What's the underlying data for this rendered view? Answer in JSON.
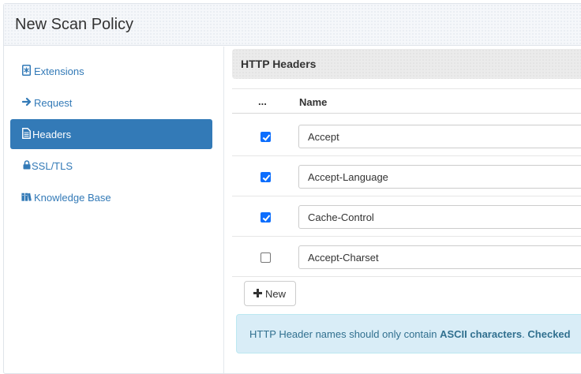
{
  "panel": {
    "title": "New Scan Policy"
  },
  "sidebar": {
    "items": [
      {
        "label": "Extensions",
        "icon": "extensions-icon",
        "active": false
      },
      {
        "label": "Request",
        "icon": "arrow-right-icon",
        "active": false
      },
      {
        "label": "Headers",
        "icon": "document-icon",
        "active": true
      },
      {
        "label": "SSL/TLS",
        "icon": "lock-icon",
        "active": false
      },
      {
        "label": "Knowledge Base",
        "icon": "books-icon",
        "active": false
      }
    ]
  },
  "main": {
    "section_title": "HTTP Headers",
    "table": {
      "columns": [
        "...",
        "Name"
      ],
      "rows": [
        {
          "checked": true,
          "name": "Accept"
        },
        {
          "checked": true,
          "name": "Accept-Language"
        },
        {
          "checked": true,
          "name": "Cache-Control"
        },
        {
          "checked": false,
          "name": "Accept-Charset"
        }
      ]
    },
    "new_button_label": "New",
    "alert": {
      "text_before": "HTTP Header names should only contain ",
      "text_bold_1": "ASCII characters",
      "text_middle": ". ",
      "text_bold_2": "Checked"
    }
  },
  "colors": {
    "accent": "#337ab7",
    "checkbox": "#0d6efd",
    "alert_bg": "#d9edf7",
    "alert_text": "#31708f"
  }
}
